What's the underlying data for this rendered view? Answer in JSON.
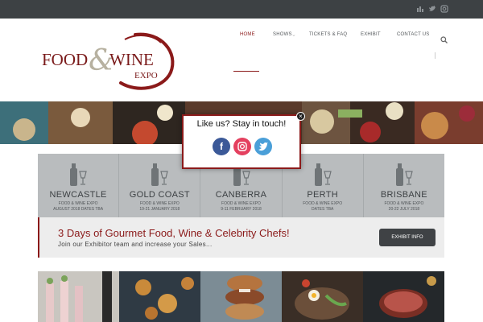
{
  "topbar": {
    "social_icons": [
      "facebook-icon",
      "twitter-icon",
      "instagram-icon"
    ]
  },
  "logo": {
    "word1": "FOOD",
    "amp": "&",
    "word2": "WINE",
    "word3": "EXPO"
  },
  "nav": {
    "items": [
      {
        "label": "HOME",
        "active": true
      },
      {
        "label": "SHOWS",
        "active": false
      },
      {
        "label": "TICKETS & FAQ",
        "active": false
      },
      {
        "label": "EXHIBIT",
        "active": false
      },
      {
        "label": "CONTACT US",
        "active": false
      }
    ],
    "search_icon": "search-icon"
  },
  "cities": [
    {
      "name": "NEWCASTLE",
      "line1": "FOOD & WINE EXPO",
      "line2": "AUGUST 2018 DATES TBA"
    },
    {
      "name": "GOLD COAST",
      "line1": "FOOD & WINE EXPO",
      "line2": "19-21 JANUARY 2018"
    },
    {
      "name": "CANBERRA",
      "line1": "FOOD & WINE EXPO",
      "line2": "9-11 FEBRUARY 2018"
    },
    {
      "name": "PERTH",
      "line1": "FOOD & WINE EXPO",
      "line2": "DATES TBA"
    },
    {
      "name": "BRISBANE",
      "line1": "FOOD & WINE EXPO",
      "line2": "20-22 JULY 2018"
    }
  ],
  "promo": {
    "headline": "3 Days of Gourmet Food, Wine & Celebrity Chefs!",
    "subline": "Join our Exhibitor team and increase your Sales...",
    "button": "EXHIBIT INFO"
  },
  "popup": {
    "title": "Like us? Stay in touch!",
    "close": "×",
    "icons": [
      "facebook-icon",
      "instagram-icon",
      "twitter-icon"
    ]
  },
  "colors": {
    "brand": "#8b1a1a",
    "topbar": "#3d4144",
    "city_panel": "#b9bcbe",
    "facebook": "#3b5998",
    "instagram": "#e4405f",
    "twitter": "#4a9fd8"
  }
}
